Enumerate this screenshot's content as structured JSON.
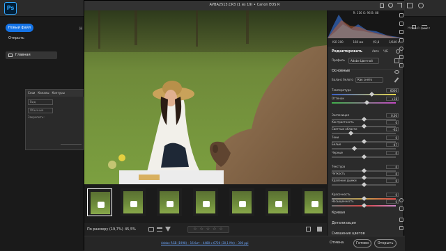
{
  "photoshop": {
    "logo": "Ps",
    "new_file": "Новый файл",
    "open": "Открыть",
    "home": "Главная",
    "right_stub": "Новый файл",
    "left_stub": "Н",
    "layers_tabs": [
      "Слои",
      "Каналы",
      "Контуры"
    ],
    "layers_search": "Вид",
    "layers_mode": "Обычные",
    "layers_lock": "Закрепить:"
  },
  "camera_raw": {
    "title": "AVBA2513.CR3 (1 из 19)  •  Canon EOS R",
    "histogram": {
      "values": "R: 116  G: 96  B: 88"
    },
    "exif": [
      "ISO 200",
      "160 мм",
      "f/2,8",
      "1/640 с"
    ],
    "edit_heading": "Редактировать",
    "auto": "Авто",
    "bw": "Ч/Б",
    "profile_label": "Профиль",
    "profile_value": "Adobe Цветной",
    "basic": "Основные",
    "wb_label": "Баланс белого",
    "wb_value": "Как снято",
    "sliders": [
      {
        "name": "Температура",
        "value": "6000",
        "pos": 0.62,
        "gradient": "linear-gradient(90deg,#3a5fc8,#e8d84a)"
      },
      {
        "name": "Оттенок",
        "value": "+18",
        "pos": 0.55,
        "gradient": "linear-gradient(90deg,#3fb24a,#c548c4)"
      },
      {
        "name": "Экспозиция",
        "value": "0,00",
        "pos": 0.5,
        "gradient": ""
      },
      {
        "name": "Контрастность",
        "value": "0",
        "pos": 0.5,
        "gradient": ""
      },
      {
        "name": "Светлые области",
        "value": "-62",
        "pos": 0.3,
        "gradient": ""
      },
      {
        "name": "Тени",
        "value": "0",
        "pos": 0.5,
        "gradient": ""
      },
      {
        "name": "Белые",
        "value": "-47",
        "pos": 0.35,
        "gradient": ""
      },
      {
        "name": "Черные",
        "value": "0",
        "pos": 0.5,
        "gradient": ""
      },
      {
        "name": "Текстура",
        "value": "0",
        "pos": 0.5,
        "gradient": ""
      },
      {
        "name": "Четкость",
        "value": "0",
        "pos": 0.5,
        "gradient": ""
      },
      {
        "name": "Удаление дымки",
        "value": "0",
        "pos": 0.5,
        "gradient": ""
      },
      {
        "name": "Красочность",
        "value": "0",
        "pos": 0.5,
        "gradient": "linear-gradient(90deg,#888,#c8a44a,#d44)"
      },
      {
        "name": "Насыщенность",
        "value": "0",
        "pos": 0.5,
        "gradient": "linear-gradient(90deg,#777,#d44,#c8c)"
      }
    ],
    "sections": [
      "Кривая",
      "Детализация",
      "Смешение цветов"
    ],
    "zoom_label": "По размеру (19,7%)",
    "zoom_value": "45,5%",
    "stars": "☆ ☆ ☆ ☆ ☆",
    "status_link": "Adobe RGB (1998) – 16 бит – 4480 х 6720 (30,1 Мп) – 300 ppi",
    "cancel": "Отмена",
    "done": "Готово",
    "open": "Открыть"
  }
}
